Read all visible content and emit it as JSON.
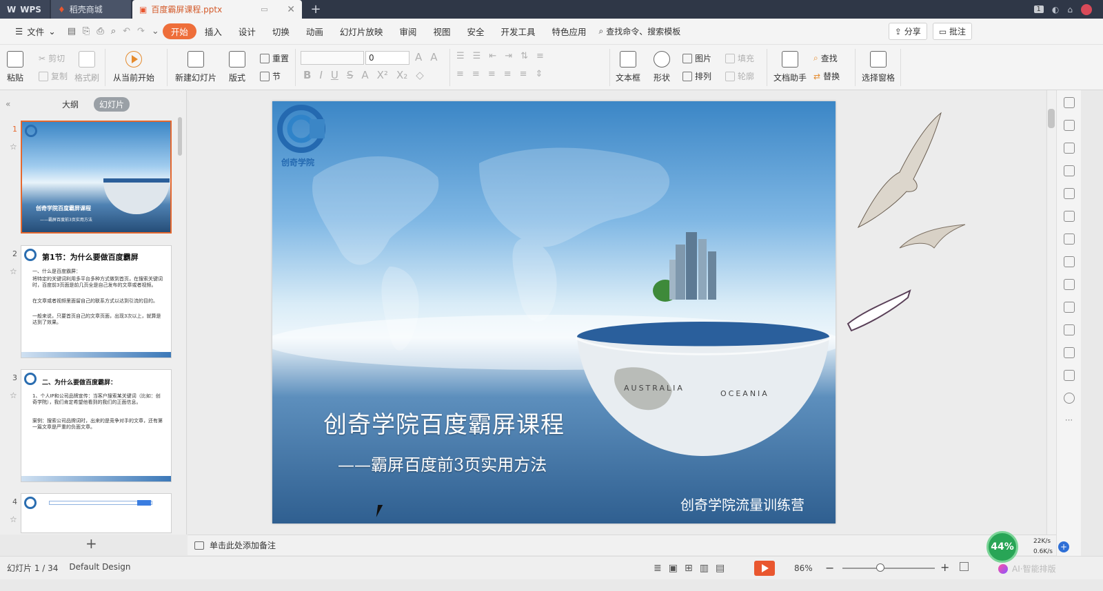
{
  "tabs": {
    "wps": "WPS",
    "store": "稻壳商城",
    "doc": "百度霸屏课程.pptx",
    "badge": "1"
  },
  "menu": {
    "file": "文件",
    "items": [
      "开始",
      "插入",
      "设计",
      "切换",
      "动画",
      "幻灯片放映",
      "审阅",
      "视图",
      "安全",
      "开发工具",
      "特色应用"
    ],
    "search": "查找命令、搜索模板",
    "share": "分享",
    "review": "批注"
  },
  "ribbon": {
    "paste": "粘贴",
    "cut": "剪切",
    "copy": "复制",
    "format_painter": "格式刷",
    "from_current": "从当前开始",
    "new_slide": "新建幻灯片",
    "layout": "版式",
    "reset": "重置",
    "section": "节",
    "font_size": "0",
    "textbox": "文本框",
    "shape": "形状",
    "picture": "图片",
    "arrange": "排列",
    "fill": "填充",
    "outline": "轮廓",
    "doc_assistant": "文档助手",
    "find": "查找",
    "replace": "替换",
    "selection_pane": "选择窗格"
  },
  "left_panel": {
    "outline_tab": "大纲",
    "slides_tab": "幻灯片",
    "thumbs": [
      {
        "num": "1",
        "title": "创奇学院百度霸屏课程",
        "sub": "——霸屏百度前3页实用方法"
      },
      {
        "num": "2",
        "title": "第1节：为什么要做百度霸屏",
        "lines": [
          "一、什么是百度霸屏：",
          "将特定的关键词利用多平台多种方式做到首页，在搜索关键词时，百度前3页面是前几页全是自己发布的文章或者视频。",
          "在文章或者视频里面留自己的联系方式以达到引流的目的。",
          "一般来说，只要首页自己的文章页面，出现3次以上，就算是达到了效果。"
        ]
      },
      {
        "num": "3",
        "title": "二、为什么要做百度霸屏：",
        "lines": [
          "1、个人IP和公司品牌宣传：当客户搜索某关键词（比如：创奇学院），我们肯定希望他看到的我们的正面信息。",
          "案例：搜索公司品牌词时，出来的是竞争对手的文章，还有第一篇文章是严重的负面文章。"
        ]
      },
      {
        "num": "4"
      }
    ]
  },
  "slide": {
    "logo_text": "创奇学院",
    "title": "创奇学院百度霸屏课程",
    "subtitle": "——霸屏百度前3页实用方法",
    "footer": "创奇学院流量训练营",
    "globe_label_1": "AUSTRALIA",
    "globe_label_2": "OCEANIA"
  },
  "notes": {
    "placeholder": "单击此处添加备注"
  },
  "status": {
    "slide_counter": "幻灯片 1 / 34",
    "theme": "Default Design",
    "zoom": "86%",
    "ai": "AI·智能排版"
  },
  "network": {
    "percent": "44%",
    "up": "22K/s",
    "down": "0.6K/s"
  },
  "colors": {
    "accent": "#ee6e3a",
    "tabbar": "#2f3747",
    "net_green": "#28a556"
  }
}
